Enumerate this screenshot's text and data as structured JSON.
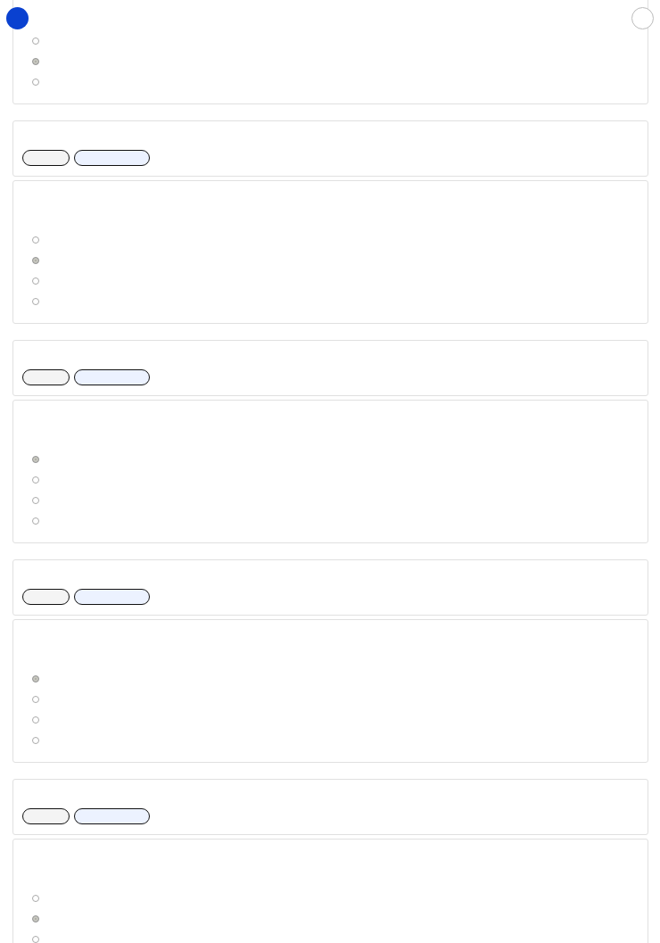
{
  "indicators": [
    {
      "filled": true
    },
    {
      "filled": false
    }
  ],
  "sections": [
    {
      "kind": "question",
      "options": [
        {
          "selected": false
        },
        {
          "selected": true
        },
        {
          "selected": false
        }
      ]
    },
    {
      "kind": "actions",
      "buttons": [
        {
          "kind": "secondary"
        },
        {
          "kind": "primary"
        }
      ]
    },
    {
      "kind": "question",
      "options": [
        {
          "selected": false
        },
        {
          "selected": true
        },
        {
          "selected": false
        },
        {
          "selected": false
        }
      ]
    },
    {
      "kind": "actions",
      "buttons": [
        {
          "kind": "secondary"
        },
        {
          "kind": "primary"
        }
      ]
    },
    {
      "kind": "question",
      "options": [
        {
          "selected": true
        },
        {
          "selected": false
        },
        {
          "selected": false
        },
        {
          "selected": false
        }
      ]
    },
    {
      "kind": "actions",
      "buttons": [
        {
          "kind": "secondary"
        },
        {
          "kind": "primary"
        }
      ]
    },
    {
      "kind": "question",
      "options": [
        {
          "selected": true
        },
        {
          "selected": false
        },
        {
          "selected": false
        },
        {
          "selected": false
        }
      ]
    },
    {
      "kind": "actions",
      "buttons": [
        {
          "kind": "secondary"
        },
        {
          "kind": "primary"
        }
      ]
    },
    {
      "kind": "question",
      "options": [
        {
          "selected": false
        },
        {
          "selected": true
        },
        {
          "selected": false
        }
      ]
    }
  ]
}
